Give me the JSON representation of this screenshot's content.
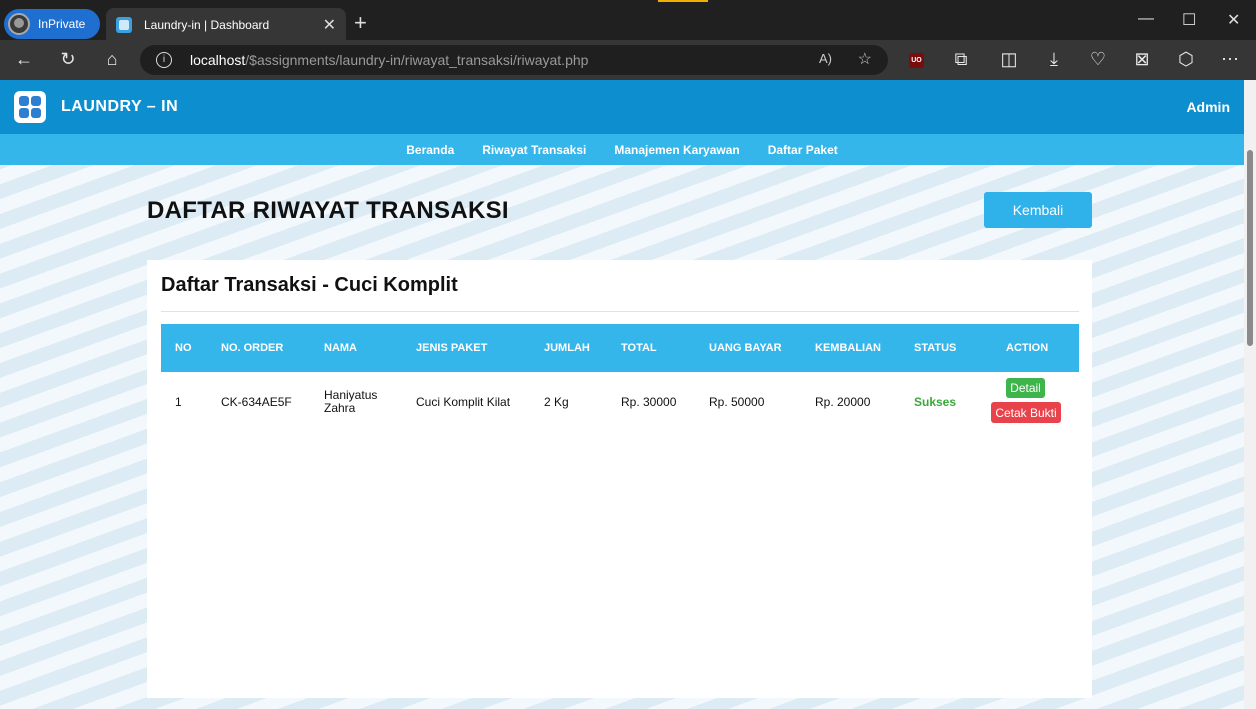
{
  "browser": {
    "inprivate_label": "InPrivate",
    "tab_title": "Laundry-in | Dashboard",
    "url_host": "localhost",
    "url_path": "/$assignments/laundry-in/riwayat_transaksi/riwayat.php",
    "read_aloud_icon": "A)"
  },
  "header": {
    "brand": "LAUNDRY – IN",
    "user": "Admin"
  },
  "nav": {
    "items": [
      "Beranda",
      "Riwayat Transaksi",
      "Manajemen Karyawan",
      "Daftar Paket"
    ]
  },
  "page": {
    "title": "DAFTAR RIWAYAT TRANSAKSI",
    "back_button": "Kembali"
  },
  "card": {
    "title": "Daftar Transaksi - Cuci Komplit",
    "columns": [
      "NO",
      "NO. ORDER",
      "NAMA",
      "JENIS PAKET",
      "JUMLAH",
      "TOTAL",
      "UANG BAYAR",
      "KEMBALIAN",
      "STATUS",
      "ACTION"
    ],
    "rows": [
      {
        "no": "1",
        "order": "CK-634AE5F",
        "nama_line1": "Haniyatus",
        "nama_line2": "Zahra",
        "paket": "Cuci Komplit Kilat",
        "jumlah": "2 Kg",
        "total": "Rp. 30000",
        "bayar": "Rp. 50000",
        "kembalian": "Rp. 20000",
        "status": "Sukses",
        "detail_label": "Detail",
        "cetak_label": "Cetak Bukti"
      }
    ]
  },
  "colors": {
    "header_bg": "#0d8fcf",
    "nav_bg": "#35b6ea",
    "status_success": "#3aa83a",
    "detail_button": "#3db54a",
    "cetak_button": "#e8424b"
  }
}
